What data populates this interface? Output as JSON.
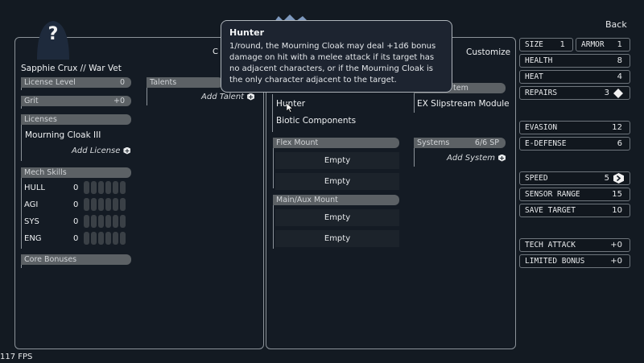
{
  "nav": {
    "back": "Back",
    "customize": "Customize",
    "cut_label": "C"
  },
  "pilot": {
    "name": "Sapphie Crux // War Vet"
  },
  "license_level": {
    "label": "License Level",
    "value": "0"
  },
  "grit": {
    "label": "Grit",
    "value": "+0"
  },
  "licenses": {
    "header": "Licenses",
    "items": [
      "Mourning Cloak III"
    ],
    "add": "Add License"
  },
  "talents": {
    "header": "Talents",
    "add": "Add Talent"
  },
  "mech_skills": {
    "header": "Mech Skills",
    "skills": [
      {
        "name": "HULL",
        "value": "0"
      },
      {
        "name": "AGI",
        "value": "0"
      },
      {
        "name": "SYS",
        "value": "0"
      },
      {
        "name": "ENG",
        "value": "0"
      }
    ]
  },
  "core_bonuses": {
    "header": "Core Bonuses"
  },
  "traits": {
    "items": [
      "Hunter",
      "Biotic Components"
    ]
  },
  "integrated": {
    "header_partial": "tem",
    "item": "EX Slipstream Module"
  },
  "flex_mount": {
    "header": "Flex Mount",
    "slots": [
      "Empty",
      "Empty"
    ]
  },
  "main_aux_mount": {
    "header": "Main/Aux Mount",
    "slots": [
      "Empty",
      "Empty"
    ]
  },
  "systems": {
    "header": "Systems",
    "sp": "6/6 SP",
    "add": "Add System"
  },
  "stats": {
    "size": {
      "label": "SIZE",
      "value": "1"
    },
    "armor": {
      "label": "ARMOR",
      "value": "1"
    },
    "health": {
      "label": "HEALTH",
      "value": "8"
    },
    "heat": {
      "label": "HEAT",
      "value": "4"
    },
    "repairs": {
      "label": "REPAIRS",
      "value": "3"
    },
    "evasion": {
      "label": "EVASION",
      "value": "12"
    },
    "e_defense": {
      "label": "E-DEFENSE",
      "value": "6"
    },
    "speed": {
      "label": "SPEED",
      "value": "5"
    },
    "sensor_range": {
      "label": "SENSOR RANGE",
      "value": "15"
    },
    "save_target": {
      "label": "SAVE TARGET",
      "value": "10"
    },
    "tech_attack": {
      "label": "TECH ATTACK",
      "value": "+0"
    },
    "limited_bonus": {
      "label": "LIMITED BONUS",
      "value": "+0"
    }
  },
  "tooltip": {
    "title": "Hunter",
    "body": "1/round, the Mourning Cloak may deal +1d6 bonus damage on hit with a melee attack if its target has no adjacent characters, or if the Mourning Cloak is the only character adjacent to the target."
  },
  "fps": "117 FPS",
  "colors": {
    "background": "#131a22",
    "header_bar": "#5c6165",
    "border": "#8c939a"
  }
}
